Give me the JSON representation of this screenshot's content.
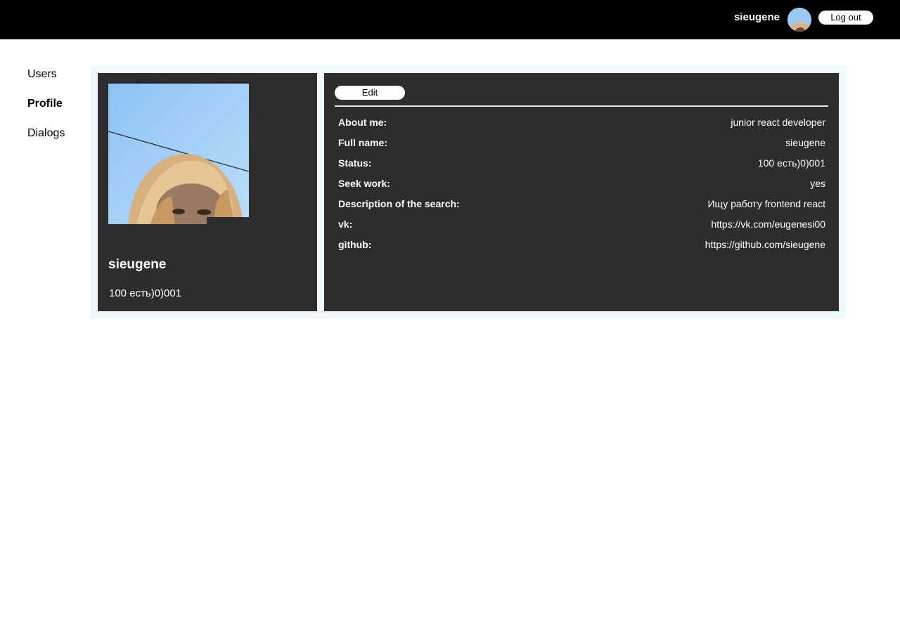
{
  "header": {
    "username": "sieugene",
    "logout_label": "Log out"
  },
  "nav": {
    "items": [
      {
        "label": "Users"
      },
      {
        "label": "Profile"
      },
      {
        "label": "Dialogs"
      }
    ]
  },
  "profile": {
    "name": "sieugene",
    "status": "100 есть)0)001",
    "edit_label": "Edit",
    "details": [
      {
        "label": "About me:",
        "value": "junior react developer"
      },
      {
        "label": "Full name:",
        "value": "sieugene"
      },
      {
        "label": "Status:",
        "value": "100 есть)0)001"
      },
      {
        "label": "Seek work:",
        "value": "yes"
      },
      {
        "label": "Description of the search:",
        "value": "Ищу работу frontend react"
      },
      {
        "label": "vk:",
        "value": "https://vk.com/eugenesi00"
      },
      {
        "label": "github:",
        "value": "https://github.com/sieugene"
      }
    ]
  },
  "colors": {
    "header_bg": "#000000",
    "card_bg": "#2d2d2d",
    "content_bg": "#eef8ff"
  }
}
